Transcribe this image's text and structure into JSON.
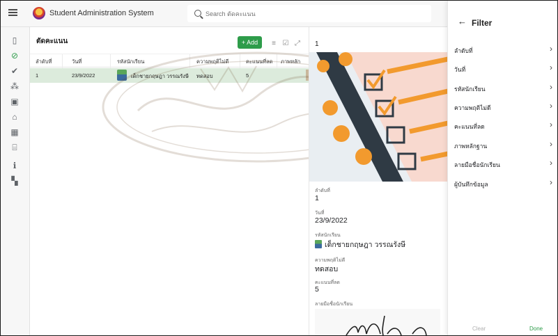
{
  "app": {
    "title": "Student Administration System",
    "search": {
      "placeholder": "Search ตัดคะแนน"
    }
  },
  "rail": {
    "items": [
      {
        "name": "address-book-icon",
        "glyph": "▯"
      },
      {
        "name": "block-icon",
        "glyph": "⊘"
      },
      {
        "name": "check-circle-icon",
        "glyph": "✔"
      },
      {
        "name": "people-icon",
        "glyph": "⁂"
      },
      {
        "name": "classroom-icon",
        "glyph": "▣"
      },
      {
        "name": "home-icon",
        "glyph": "⌂"
      },
      {
        "name": "calendar-icon",
        "glyph": "▦"
      },
      {
        "name": "bank-icon",
        "glyph": "⌸"
      },
      {
        "name": "info-icon",
        "glyph": "ℹ"
      },
      {
        "name": "grid-icon",
        "glyph": "▚"
      }
    ]
  },
  "list": {
    "title": "ตัดคะแนน",
    "add_label": "+ Add",
    "columns": [
      "ลำดับที่",
      "วันที่",
      "รหัสนักเรียน",
      "ความพฤติไม่ดี",
      "คะแนนที่ลด",
      "ภาพหลัก"
    ],
    "rows": [
      {
        "order": "1",
        "date": "23/9/2022",
        "student": "เด็กชายกฤษฎา วรรณรังษี",
        "behavior": "ทดสอบ",
        "points": "5"
      }
    ]
  },
  "detail": {
    "header_value": "1",
    "fields": [
      {
        "label": "ลำดับที่",
        "value": "1"
      },
      {
        "label": "วันที่",
        "value": "23/9/2022"
      },
      {
        "label": "รหัสนักเรียน",
        "value": "เด็กชายกฤษฎา  วรรณรังษี"
      },
      {
        "label": "ความพฤติไม่ดี",
        "value": "ทดสอบ"
      },
      {
        "label": "คะแนนที่ลด",
        "value": "5"
      },
      {
        "label": "ลายมือชื่อนักเรียน",
        "value": ""
      }
    ]
  },
  "filter": {
    "title": "Filter",
    "items": [
      "ลำดับที่",
      "วันที่",
      "รหัสนักเรียน",
      "ความพฤติไม่ดี",
      "คะแนนที่ลด",
      "ภาพหลักฐาน",
      "ลายมือชื่อนักเรียน",
      "ผู้บันทึกข้อมูล"
    ],
    "clear_label": "Clear",
    "done_label": "Done"
  },
  "colors": {
    "accent": "#2e9c4a",
    "row_selected": "#dcebdc",
    "hero_bg": "#f8d9cf",
    "hero_orange": "#f29a2e"
  }
}
